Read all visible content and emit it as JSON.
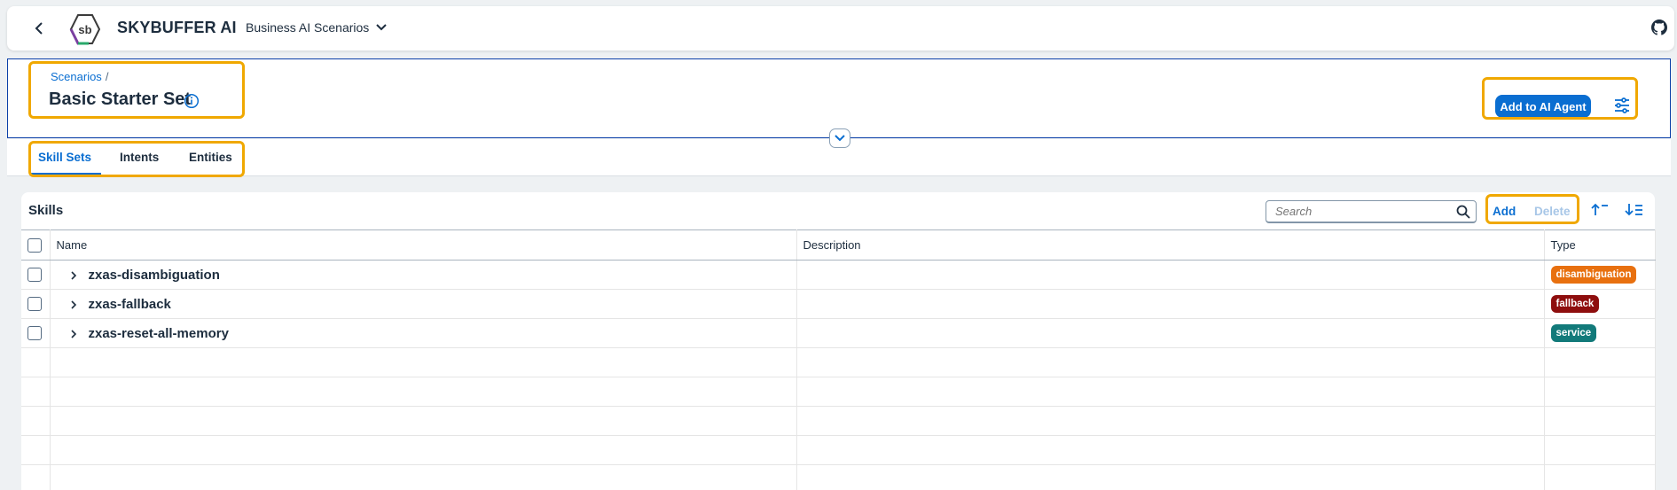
{
  "shell": {
    "brand": "SKYBUFFER AI",
    "product": "Business AI Scenarios",
    "icons": [
      "back-arrow-icon",
      "skybuffer-logo",
      "chevron-down-icon",
      "github-icon"
    ]
  },
  "header": {
    "breadcrumb_link": "Scenarios",
    "breadcrumb_sep": "/",
    "title": "Basic Starter Set",
    "add_agent_label": "Add to AI Agent"
  },
  "tabs": [
    {
      "label": "Skill Sets",
      "active": true
    },
    {
      "label": "Intents",
      "active": false
    },
    {
      "label": "Entities",
      "active": false
    }
  ],
  "skills": {
    "title": "Skills",
    "search_placeholder": "Search",
    "add_label": "Add",
    "delete_label": "Delete",
    "columns": [
      "Name",
      "Description",
      "Type"
    ],
    "rows": [
      {
        "name": "zxas-disambiguation",
        "description": "",
        "type": "disambiguation",
        "type_color": "#e8700f"
      },
      {
        "name": "zxas-fallback",
        "description": "",
        "type": "fallback",
        "type_color": "#8e0e0e"
      },
      {
        "name": "zxas-reset-all-memory",
        "description": "",
        "type": "service",
        "type_color": "#127a7a"
      }
    ]
  },
  "colors": {
    "accent": "#0a6ed1",
    "highlight": "#f0a800"
  }
}
